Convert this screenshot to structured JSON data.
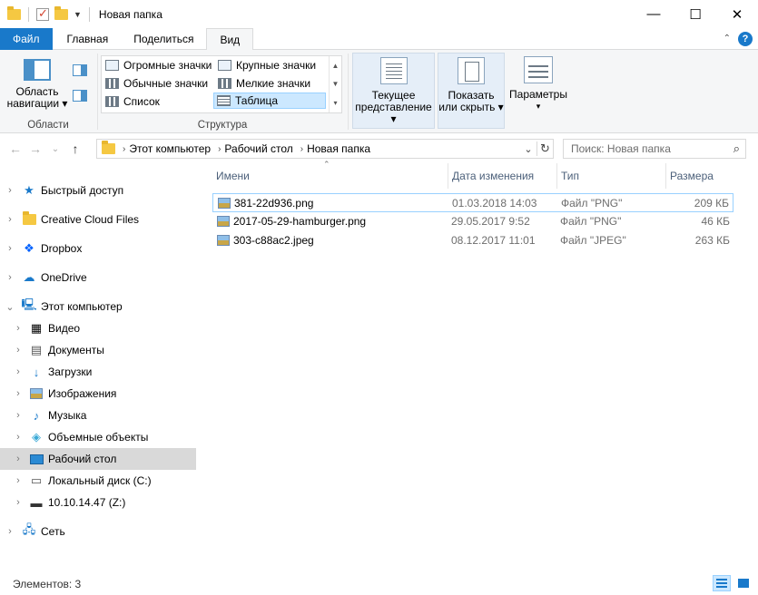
{
  "window": {
    "title": "Новая папка"
  },
  "tabs": {
    "file": "Файл",
    "home": "Главная",
    "share": "Поделиться",
    "view": "Вид"
  },
  "ribbon": {
    "nav_pane_line1": "Область",
    "nav_pane_line2": "навигации ▾",
    "group_panes": "Области",
    "layout": {
      "huge_icons": "Огромные значки",
      "large_icons": "Крупные значки",
      "medium_icons": "Обычные значки",
      "small_icons": "Мелкие значки",
      "list": "Список",
      "details": "Таблица"
    },
    "group_layout": "Структура",
    "current_view_line1": "Текущее",
    "current_view_line2": "представление ▾",
    "show_hide_line1": "Показать",
    "show_hide_line2": "или скрыть ▾",
    "options": "Параметры",
    "options_caret": "▾"
  },
  "address": {
    "segments": [
      "Этот компьютер",
      "Рабочий стол",
      "Новая папка"
    ],
    "search_placeholder": "Поиск: Новая папка"
  },
  "nav": {
    "quick_access": "Быстрый доступ",
    "creative_cloud": "Creative Cloud Files",
    "dropbox": "Dropbox",
    "onedrive": "OneDrive",
    "this_pc": "Этот компьютер",
    "video": "Видео",
    "documents": "Документы",
    "downloads": "Загрузки",
    "images": "Изображения",
    "music": "Музыка",
    "objects3d": "Объемные объекты",
    "desktop": "Рабочий стол",
    "local_disk": "Локальный диск (C:)",
    "network_drive": "10.10.14.47 (Z:)",
    "network": "Сеть"
  },
  "columns": {
    "name": "Имени",
    "date": "Дата изменения",
    "type": "Тип",
    "size": "Размера"
  },
  "files": [
    {
      "name": "381-22d936.png",
      "date": "01.03.2018 14:03",
      "type": "Файл \"PNG\"",
      "size": "209 КБ"
    },
    {
      "name": "2017-05-29-hamburger.png",
      "date": "29.05.2017 9:52",
      "type": "Файл \"PNG\"",
      "size": "46 КБ"
    },
    {
      "name": "303-c88ac2.jpeg",
      "date": "08.12.2017 11:01",
      "type": "Файл \"JPEG\"",
      "size": "263 КБ"
    }
  ],
  "status": {
    "items": "Элементов: 3"
  }
}
